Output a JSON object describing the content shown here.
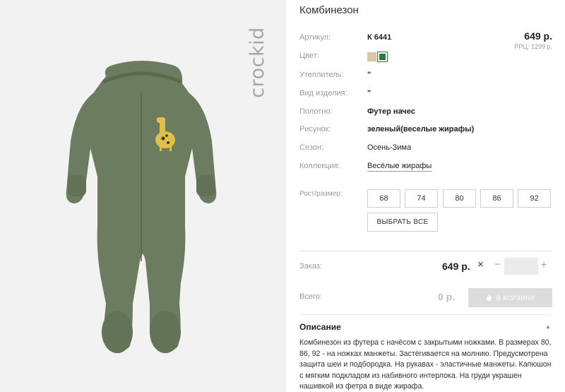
{
  "brand": "crockid",
  "product": {
    "title": "Комбинезон",
    "price": "649 р.",
    "rrp": "РРЦ: 1299 р."
  },
  "attributes": {
    "article": {
      "label": "Артикул:",
      "value": "К 6441"
    },
    "color": {
      "label": "Цвет:"
    },
    "insulation": {
      "label": "Утеплитель:",
      "value": "\""
    },
    "kind": {
      "label": "Вид изделия:",
      "value": "\""
    },
    "fabric": {
      "label": "Полотно:",
      "value": "Футер начес"
    },
    "print": {
      "label": "Рисунок:",
      "value": "зеленый(веселые жирафы)"
    },
    "season": {
      "label": "Сезон:",
      "value": "Осень-Зима"
    },
    "collection": {
      "label": "Коллекция:",
      "value": "Весёлые жирафы"
    }
  },
  "colors": [
    "#d8c7a5",
    "#2f7a3e"
  ],
  "sizes": {
    "label": "Рост/размер:",
    "options": [
      "68",
      "74",
      "80",
      "86",
      "92"
    ],
    "select_all": "ВЫБРАТЬ ВСЕ"
  },
  "order": {
    "label": "Заказ:",
    "price": "649 р.",
    "remove_icon": "×",
    "minus": "−",
    "quantity": "",
    "plus": "+"
  },
  "total": {
    "label": "Всего:",
    "value": "0 р.",
    "cart_button": "В КОРЗИНУ"
  },
  "description": {
    "heading": "Описание",
    "text": "Комбинезон из футера с начёсом с закрытыми ножками. В размерах 80, 86, 92 - на ножках манжеты. Застёгивается на молнию. Предусмотрена защита шеи и подбородка. На рукавах - эластичные манжеты. Капюшон с мягким подкладом из набивного интерлока. На груди украшен нашивкой из фетра в виде жирафа."
  }
}
